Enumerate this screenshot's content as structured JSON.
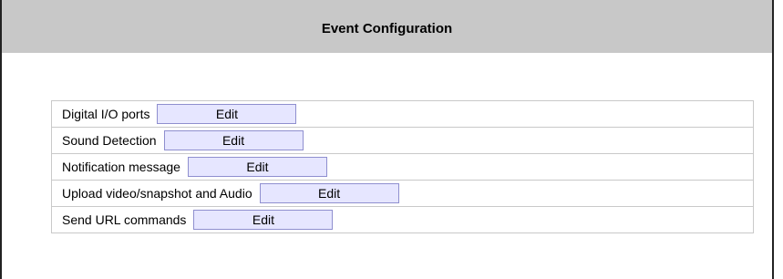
{
  "header": {
    "title": "Event Configuration"
  },
  "rows": [
    {
      "label": "Digital I/O ports",
      "button_label": "Edit"
    },
    {
      "label": "Sound Detection",
      "button_label": "Edit"
    },
    {
      "label": "Notification message",
      "button_label": "Edit"
    },
    {
      "label": "Upload video/snapshot and Audio",
      "button_label": "Edit"
    },
    {
      "label": "Send URL commands",
      "button_label": "Edit"
    }
  ],
  "colors": {
    "header_background": "#c8c8c8",
    "button_background": "#e6e6ff",
    "button_border": "#8f8fcf",
    "row_border": "#c9c9c9"
  }
}
